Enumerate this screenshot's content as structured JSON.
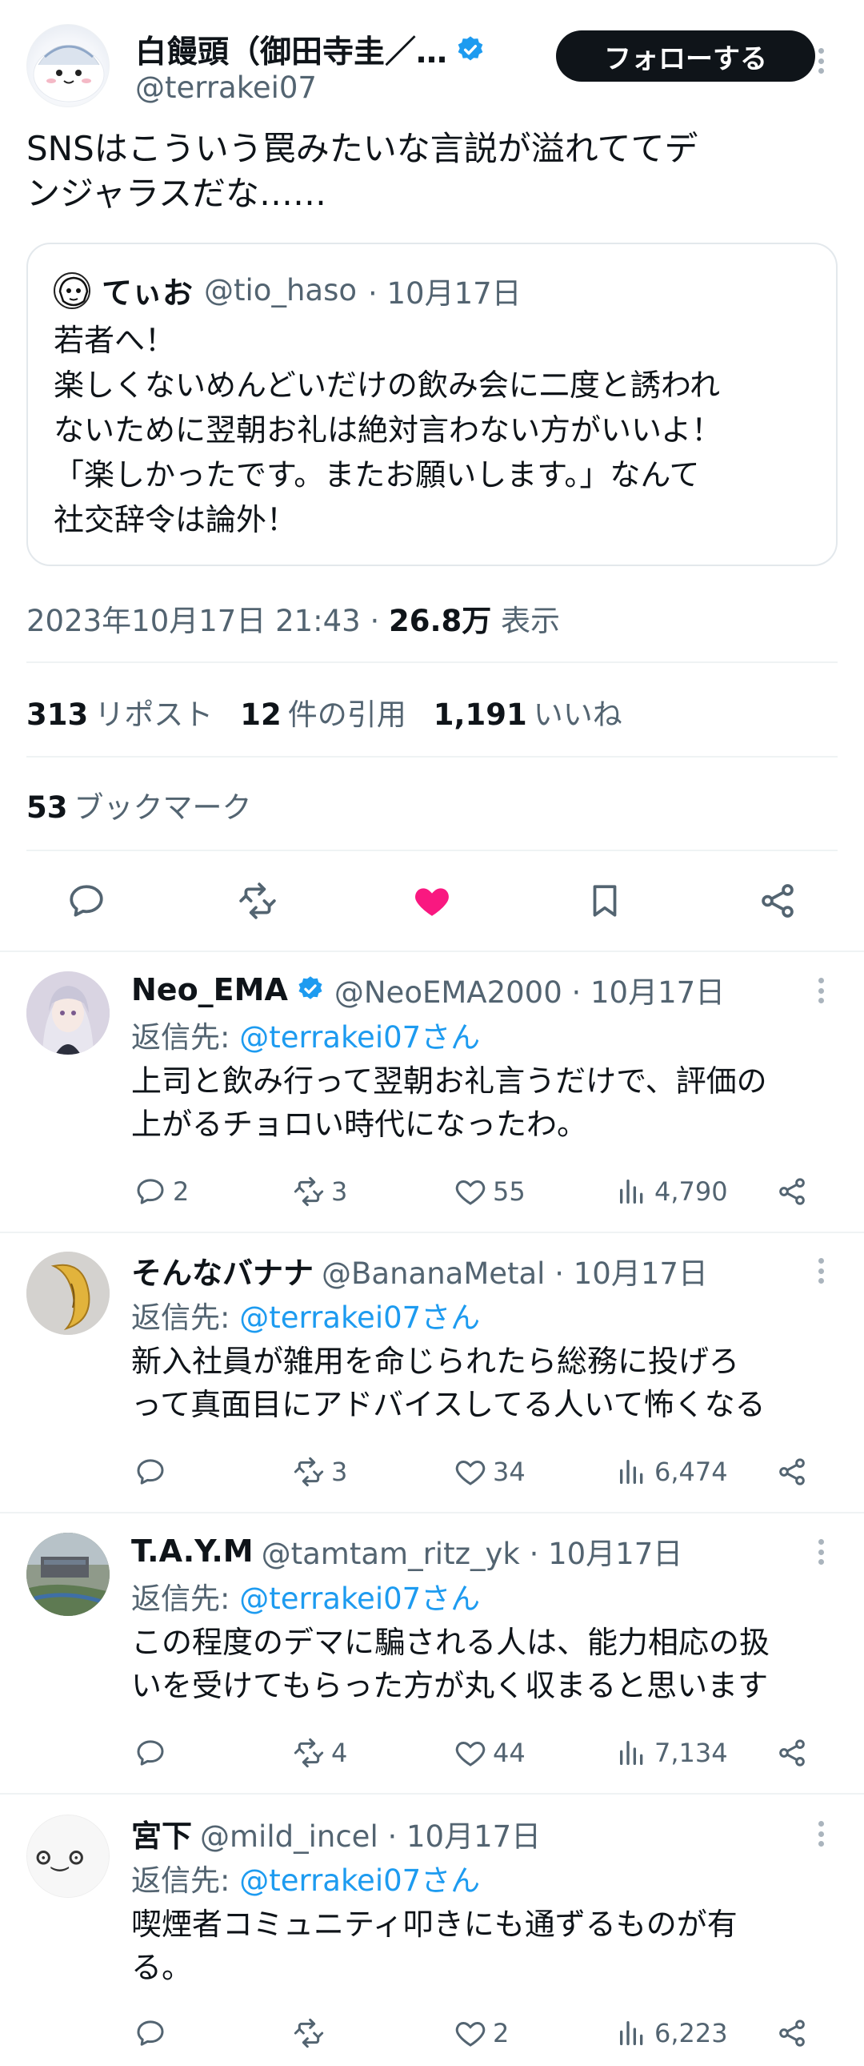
{
  "tweet": {
    "author_name": "白饅頭（御田寺圭／…",
    "author_handle": "@terrakei07",
    "follow_label": "フォローする",
    "text_lines": [
      "SNSはこういう罠みたいな言説が溢れててデ",
      "ンジャラスだな……"
    ],
    "quote": {
      "name": "てぃお",
      "handle": "@tio_haso",
      "date": "· 10月17日",
      "lines": [
        "若者へ！",
        "楽しくないめんどいだけの飲み会に二度と誘われ",
        "ないために翌朝お礼は絶対言わない方がいいよ！",
        "「楽しかったです。またお願いします。」なんて",
        "社交辞令は論外！"
      ]
    },
    "timestamp": "2023年10月17日 21:43 · ",
    "views_count": "26.8万",
    "views_label": " 表示",
    "stats": {
      "reposts_count": "313",
      "reposts_label": "リポスト",
      "quotes_count": "12",
      "quotes_label": "件の引用",
      "likes_count": "1,191",
      "likes_label": "いいね",
      "bookmarks_count": "53",
      "bookmarks_label": "ブックマーク"
    },
    "liked": true,
    "like_color": "#f91880"
  },
  "replies": [
    {
      "name": "Neo_EMA",
      "verified": true,
      "handle": "@NeoEMA2000 · 10月17日",
      "reply_to_label": "返信先: ",
      "reply_to_mention": "@terrakei07さん",
      "lines": [
        "上司と飲み行って翌朝お礼言うだけで、評価の",
        "上がるチョロい時代になったわ。"
      ],
      "replies": "2",
      "reposts": "3",
      "likes": "55",
      "views": "4,790"
    },
    {
      "name": "そんなバナナ",
      "verified": false,
      "handle": "@BananaMetal · 10月17日",
      "reply_to_label": "返信先: ",
      "reply_to_mention": "@terrakei07さん",
      "lines": [
        "新入社員が雑用を命じられたら総務に投げろ",
        "って真面目にアドバイスしてる人いて怖くなる"
      ],
      "replies": "",
      "reposts": "3",
      "likes": "34",
      "views": "6,474"
    },
    {
      "name": "T.A.Y.M",
      "verified": false,
      "handle": "@tamtam_ritz_yk · 10月17日",
      "reply_to_label": "返信先: ",
      "reply_to_mention": "@terrakei07さん",
      "lines": [
        "この程度のデマに騙される人は、能力相応の扱",
        "いを受けてもらった方が丸く収まると思います"
      ],
      "replies": "",
      "reposts": "4",
      "likes": "44",
      "views": "7,134"
    },
    {
      "name": "宮下",
      "verified": false,
      "handle": "@mild_incel · 10月17日",
      "reply_to_label": "返信先: ",
      "reply_to_mention": "@terrakei07さん",
      "lines": [
        "喫煙者コミュニティ叩きにも通ずるものが有",
        "る。"
      ],
      "replies": "",
      "reposts": "",
      "likes": "2",
      "views": "6,223"
    }
  ],
  "icons": {
    "verified": "verified-badge-icon",
    "more": "more-options-icon",
    "reply": "reply-bubble-icon",
    "repost": "repost-arrows-icon",
    "like": "heart-icon",
    "bookmark": "bookmark-icon",
    "share": "share-icon",
    "views": "bar-chart-icon"
  },
  "colors": {
    "text": "#0f1419",
    "secondary": "#536471",
    "link": "#1d9bf0",
    "follow_bg": "#0f1419"
  }
}
